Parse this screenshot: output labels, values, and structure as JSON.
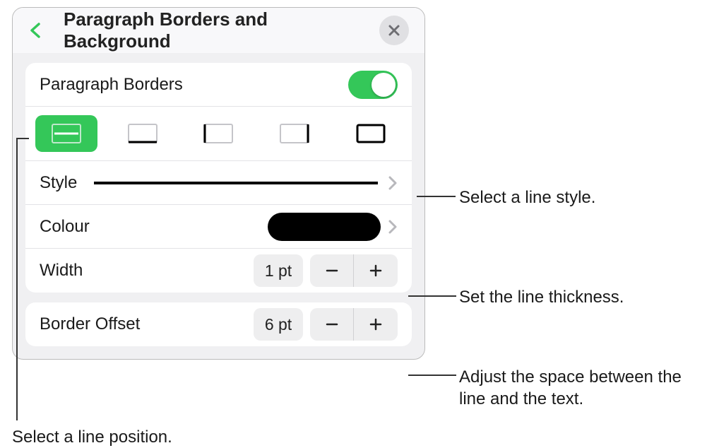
{
  "header": {
    "title": "Paragraph Borders and Background"
  },
  "toggle": {
    "label": "Paragraph Borders",
    "on": true
  },
  "borderPositions": [
    {
      "name": "middle",
      "selected": true
    },
    {
      "name": "bottom",
      "selected": false
    },
    {
      "name": "left",
      "selected": false
    },
    {
      "name": "right",
      "selected": false
    },
    {
      "name": "all",
      "selected": false
    }
  ],
  "style": {
    "label": "Style"
  },
  "colour": {
    "label": "Colour",
    "hex": "#000000"
  },
  "width": {
    "label": "Width",
    "value": "1 pt"
  },
  "offset": {
    "label": "Border Offset",
    "value": "6 pt"
  },
  "callouts": {
    "style": "Select a line style.",
    "width": "Set the line thickness.",
    "offset": "Adjust the space between the line and the text.",
    "position": "Select a line position."
  }
}
